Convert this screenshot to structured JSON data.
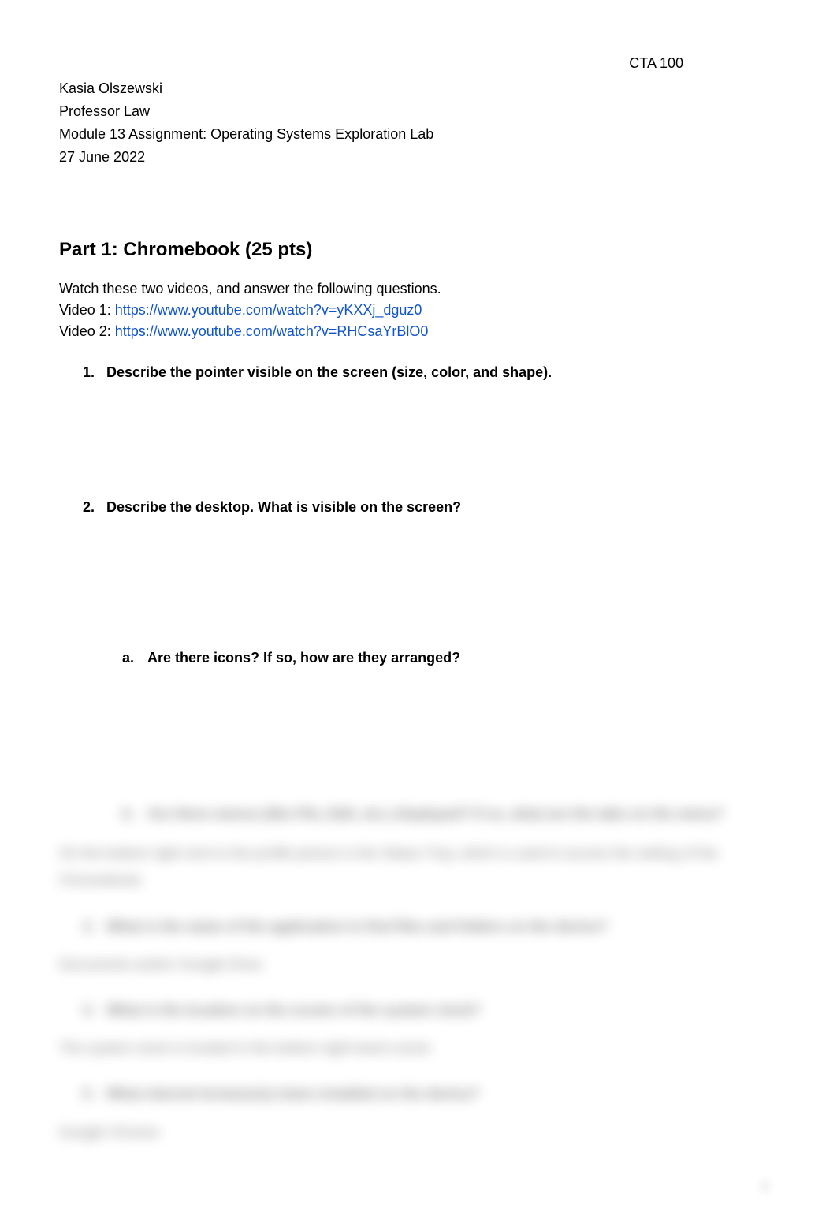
{
  "header": {
    "course": "CTA 100"
  },
  "student": {
    "name": "Kasia Olszewski",
    "professor": "Professor Law",
    "assignment": "Module 13 Assignment: Operating Systems Exploration Lab",
    "date": "27 June 2022"
  },
  "part1": {
    "heading": "Part 1: Chromebook (25 pts)",
    "intro": "Watch these two videos, and answer the following questions.",
    "video1_label": "Video 1: ",
    "video1_url": "https://www.youtube.com/watch?v=yKXXj_dguz0",
    "video2_label": "Video 2: ",
    "video2_url": "https://www.youtube.com/watch?v=RHCsaYrBlO0",
    "questions": {
      "q1_marker": "1.",
      "q1_text": "Describe the pointer visible on the screen (size, color, and shape).",
      "q2_marker": "2.",
      "q2_text": "Describe the desktop. What is visible on the screen?",
      "q2a_marker": "a.",
      "q2a_text": "Are there icons? If so, how are they arranged?"
    }
  },
  "blurred": {
    "b_marker": "b.",
    "b_text": "Are there menus (like File, Edit, etc.) displayed? If so, what are the tabs on the menu?",
    "b_answer": "On the bottom right next to the profile picture is the Status Tray, which is used to access the setting of the Chromebook.",
    "q3_marker": "3.",
    "q3_text": "What is the name of the application to find files and folders on the device?",
    "q3_answer": "Documents and/or Google Drive.",
    "q4_marker": "4.",
    "q4_text": "What is the location on the screen of the system clock?",
    "q4_answer": "The system clock is located in the bottom right-hand corner.",
    "q5_marker": "5.",
    "q5_text": "What internet browser(s) is/are installed on the device?",
    "q5_answer": "Google Chrome"
  },
  "footer": {
    "page_num": "1"
  }
}
